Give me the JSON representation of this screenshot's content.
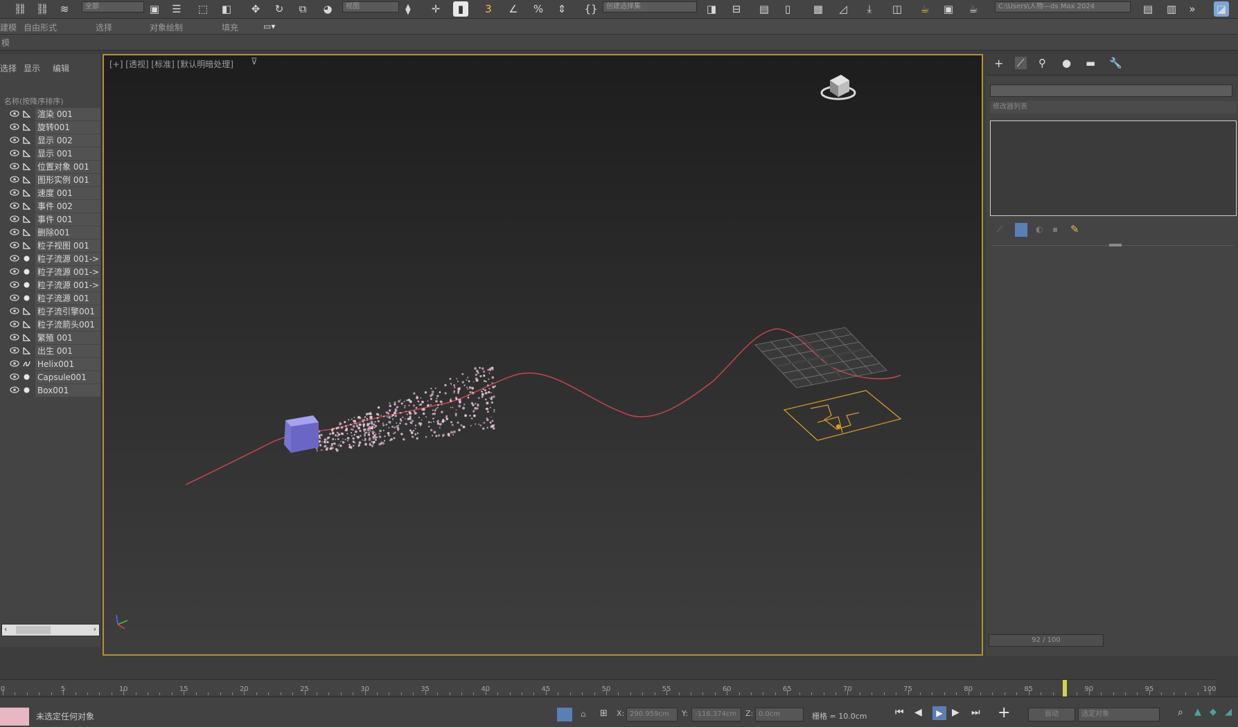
{
  "toolbar": {
    "selection_filter": "全部",
    "ref_coord": "视图",
    "named_selection": "创建选择集",
    "project_path": "C:\\Users\\人物—ds Max 2024"
  },
  "ribbon": {
    "tabs": [
      "建模",
      "自由形式",
      "选择",
      "对象绘制",
      "填充"
    ],
    "sub_label": "模"
  },
  "explorer": {
    "tabs": [
      "选择",
      "显示",
      "编辑"
    ],
    "header": "名称(按降序排序)",
    "items": [
      {
        "name": "渲染 001",
        "kind": "flow"
      },
      {
        "name": "旋转001",
        "kind": "flow"
      },
      {
        "name": "显示 002",
        "kind": "flow"
      },
      {
        "name": "显示 001",
        "kind": "flow"
      },
      {
        "name": "位置对象 001",
        "kind": "flow"
      },
      {
        "name": "图形实例 001",
        "kind": "flow"
      },
      {
        "name": "速度 001",
        "kind": "flow"
      },
      {
        "name": "事件 002",
        "kind": "flow"
      },
      {
        "name": "事件 001",
        "kind": "flow"
      },
      {
        "name": "删除001",
        "kind": "flow"
      },
      {
        "name": "粒子视图 001",
        "kind": "flow"
      },
      {
        "name": "粒子流源 001->",
        "kind": "dot"
      },
      {
        "name": "粒子流源 001->",
        "kind": "dot"
      },
      {
        "name": "粒子流源 001->",
        "kind": "dot"
      },
      {
        "name": "粒子流源 001",
        "kind": "dot"
      },
      {
        "name": "粒子流引擎001",
        "kind": "flow"
      },
      {
        "name": "粒子流箭头001",
        "kind": "flow"
      },
      {
        "name": "繁殖 001",
        "kind": "flow"
      },
      {
        "name": "出生 001",
        "kind": "flow"
      },
      {
        "name": "Helix001",
        "kind": "helix"
      },
      {
        "name": "Capsule001",
        "kind": "dot"
      },
      {
        "name": "Box001",
        "kind": "dot"
      }
    ]
  },
  "viewport": {
    "label": "[+] [透视] [标准] [默认明暗处理]",
    "border_color": "#b0952b",
    "spline_color": "#c4474f",
    "particle_color": "#e6c3d8",
    "box_color": "#8a85e0",
    "gizmo_color": "#d59a2c"
  },
  "command_panel": {
    "section_label": "修改器列表"
  },
  "timeline": {
    "frame_display": "92 / 100",
    "ticks": [
      0,
      5,
      10,
      15,
      20,
      25,
      30,
      35,
      40,
      45,
      50,
      55,
      60,
      65,
      70,
      75,
      80,
      85,
      90,
      95,
      100
    ],
    "current_frame": 88
  },
  "status": {
    "message": "未选定任何对象",
    "x_label": "X:",
    "x_value": "290.959cm",
    "y_label": "Y:",
    "y_value": "-116.374cm",
    "z_label": "Z:",
    "z_value": "0.0cm",
    "grid": "栅格 = 10.0cm",
    "auto_key": "自动",
    "selected": "选定对象"
  }
}
